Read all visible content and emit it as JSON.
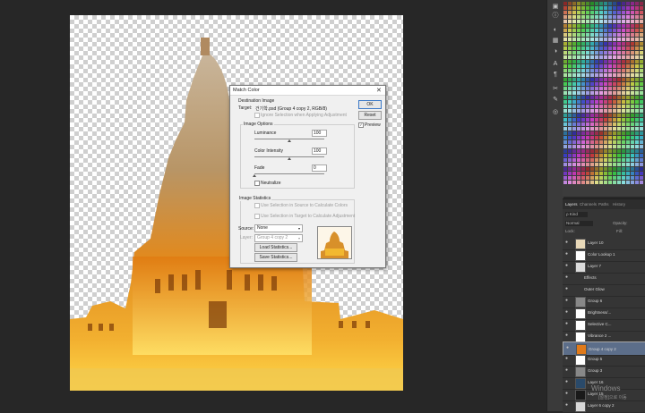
{
  "dialog": {
    "title": "Match Color",
    "close_glyph": "✕",
    "destination_heading": "Destination Image",
    "target_label": "Target:",
    "target_value": "건기학.psd (Group 4 copy 2, RGB/8)",
    "ignore_selection": "Ignore Selection when Applying Adjustment",
    "image_options_heading": "Image Options",
    "luminance_label": "Luminance",
    "luminance_value": "100",
    "luminance_level": 0.5,
    "color_intensity_label": "Color Intensity",
    "color_intensity_value": "100",
    "color_intensity_level": 0.5,
    "fade_label": "Fade",
    "fade_value": "0",
    "fade_level": 0,
    "neutralize_label": "Neutralize",
    "image_statistics_heading": "Image Statistics",
    "use_sel_source": "Use Selection in Source to Calculate Colors",
    "use_sel_target": "Use Selection in Target to Calculate Adjustment",
    "source_label": "Source:",
    "source_value": "None",
    "layer_label": "Layer:",
    "layer_value": "Group 4 copy 2",
    "load_stats": "Load Statistics...",
    "save_stats": "Save Statistics...",
    "ok_label": "OK",
    "reset_label": "Reset",
    "preview_label": "Preview",
    "preview_checked": "✓"
  },
  "layers_panel": {
    "tabs": [
      "Layers",
      "Channels",
      "Paths",
      "History"
    ],
    "kind_label": "ρ Kind",
    "blend_mode": "Normal",
    "opacity_label": "Opacity:",
    "lock_label": "Lock:",
    "fill_label": "Fill:",
    "rows": [
      {
        "name": "Layer 10",
        "thumb": "#e8d8b8"
      },
      {
        "name": "Color Lookup 1",
        "thumb": "#ffffff"
      },
      {
        "name": "Layer 7",
        "thumb": "#dcdcdc"
      },
      {
        "name": "Effects",
        "thumb": ""
      },
      {
        "name": "Outer Glow",
        "thumb": ""
      },
      {
        "name": "Group 6",
        "thumb": "#888888"
      },
      {
        "name": "Brightness/...",
        "thumb": "#ffffff"
      },
      {
        "name": "Selective C...",
        "thumb": "#ffffff"
      },
      {
        "name": "Vibrance 2 ...",
        "thumb": "#ffffff"
      },
      {
        "name": "Group 4 copy 2",
        "thumb": "#e07a1a"
      },
      {
        "name": "Group 5",
        "thumb": "#ffffff"
      },
      {
        "name": "Group 3",
        "thumb": "#888888"
      },
      {
        "name": "Layer 16",
        "thumb": "#2a4a6a"
      },
      {
        "name": "Layer 15",
        "thumb": "#1a1a1a"
      },
      {
        "name": "Layer 6 copy 2",
        "thumb": "#d8d8d8"
      }
    ]
  },
  "watermark": {
    "line1": "Windows",
    "line2": "[설정]으로 이동"
  },
  "colors": {
    "accent": "#3b79c7",
    "selected_layer": "#5c6e8a"
  }
}
